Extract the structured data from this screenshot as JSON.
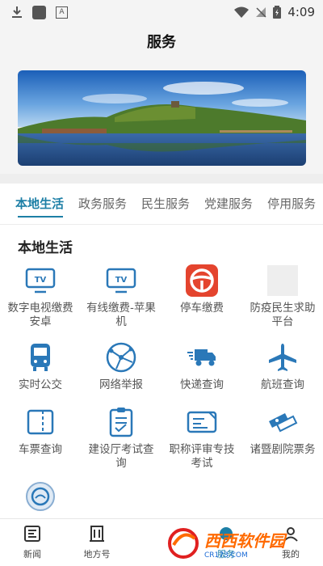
{
  "status_bar": {
    "time": "4:09"
  },
  "header": {
    "title": "服务"
  },
  "tabs": [
    {
      "label": "本地生活",
      "active": true
    },
    {
      "label": "政务服务"
    },
    {
      "label": "民生服务"
    },
    {
      "label": "党建服务"
    },
    {
      "label": "停用服务"
    }
  ],
  "section": {
    "title": "本地生活"
  },
  "services": [
    {
      "label": "数字电视缴费安卓",
      "icon": "tv-icon"
    },
    {
      "label": "有线缴费-苹果机",
      "icon": "tv-icon"
    },
    {
      "label": "停车缴费",
      "icon": "parking-wheel-icon"
    },
    {
      "label": "防疫民生求助平台",
      "icon": "placeholder-icon"
    },
    {
      "label": "实时公交",
      "icon": "bus-icon"
    },
    {
      "label": "网络举报",
      "icon": "network-globe-icon"
    },
    {
      "label": "快递查询",
      "icon": "delivery-truck-icon"
    },
    {
      "label": "航班查询",
      "icon": "airplane-icon"
    },
    {
      "label": "车票查询",
      "icon": "ticket-icon"
    },
    {
      "label": "建设厅考试查询",
      "icon": "clipboard-icon"
    },
    {
      "label": "职称评审专技考试",
      "icon": "id-card-icon"
    },
    {
      "label": "诸暨剧院票务",
      "icon": "theater-ticket-icon"
    },
    {
      "label": "",
      "icon": "weather-badge-icon"
    }
  ],
  "bottom_nav": [
    {
      "label": "新闻",
      "icon": "news-icon"
    },
    {
      "label": "地方号",
      "icon": "building-icon"
    },
    {
      "label": "",
      "icon": ""
    },
    {
      "label": "服务",
      "icon": "service-icon",
      "active": true
    },
    {
      "label": "我的",
      "icon": "profile-icon"
    }
  ],
  "watermark": {
    "text": "西西软件园",
    "sub": "CR173.COM"
  },
  "colors": {
    "accent": "#1d7fa6",
    "icon_blue": "#2a78b8",
    "parking_red": "#e4442e"
  }
}
